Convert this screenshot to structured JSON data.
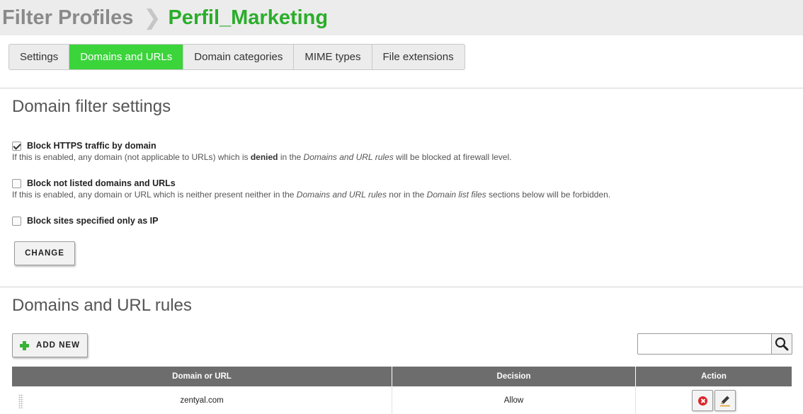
{
  "header": {
    "parent": "Filter Profiles",
    "separator": "❯",
    "current": "Perfil_Marketing"
  },
  "tabs": [
    {
      "label": "Settings",
      "active": false
    },
    {
      "label": "Domains and URLs",
      "active": true
    },
    {
      "label": "Domain categories",
      "active": false
    },
    {
      "label": "MIME types",
      "active": false
    },
    {
      "label": "File extensions",
      "active": false
    }
  ],
  "domain_filter": {
    "title": "Domain filter settings",
    "options": [
      {
        "label": "Block HTTPS traffic by domain",
        "checked": true,
        "help": {
          "p1": "If this is enabled, any domain (not applicable to URLs) which is ",
          "b1": "denied",
          "p2": " in the ",
          "i1": "Domains and URL rules",
          "p3": " will be blocked at firewall level."
        }
      },
      {
        "label": "Block not listed domains and URLs",
        "checked": false,
        "help": {
          "p1": "If this is enabled, any domain or URL which is neither present neither in the ",
          "i1": "Domains and URL rules",
          "p2": " nor in the ",
          "i2": "Domain list files",
          "p3": " sections below will be forbidden."
        }
      },
      {
        "label": "Block sites specified only as IP",
        "checked": false
      }
    ],
    "change_button": "CHANGE"
  },
  "rules": {
    "title": "Domains and URL rules",
    "add_button": "ADD NEW",
    "search": {
      "value": "",
      "placeholder": ""
    },
    "columns": [
      "Domain or URL",
      "Decision",
      "Action"
    ],
    "rows": [
      {
        "domain": "zentyal.com",
        "decision": "Allow"
      }
    ]
  },
  "colors": {
    "accent_green": "#3bd43b",
    "title_green": "#2bad2b",
    "table_header": "#6d6d6d",
    "delete_red": "#d9262a"
  },
  "icons": [
    "chevron-right-icon",
    "check-icon",
    "plus-icon",
    "search-icon",
    "delete-icon",
    "edit-icon",
    "drag-handle-icon"
  ]
}
